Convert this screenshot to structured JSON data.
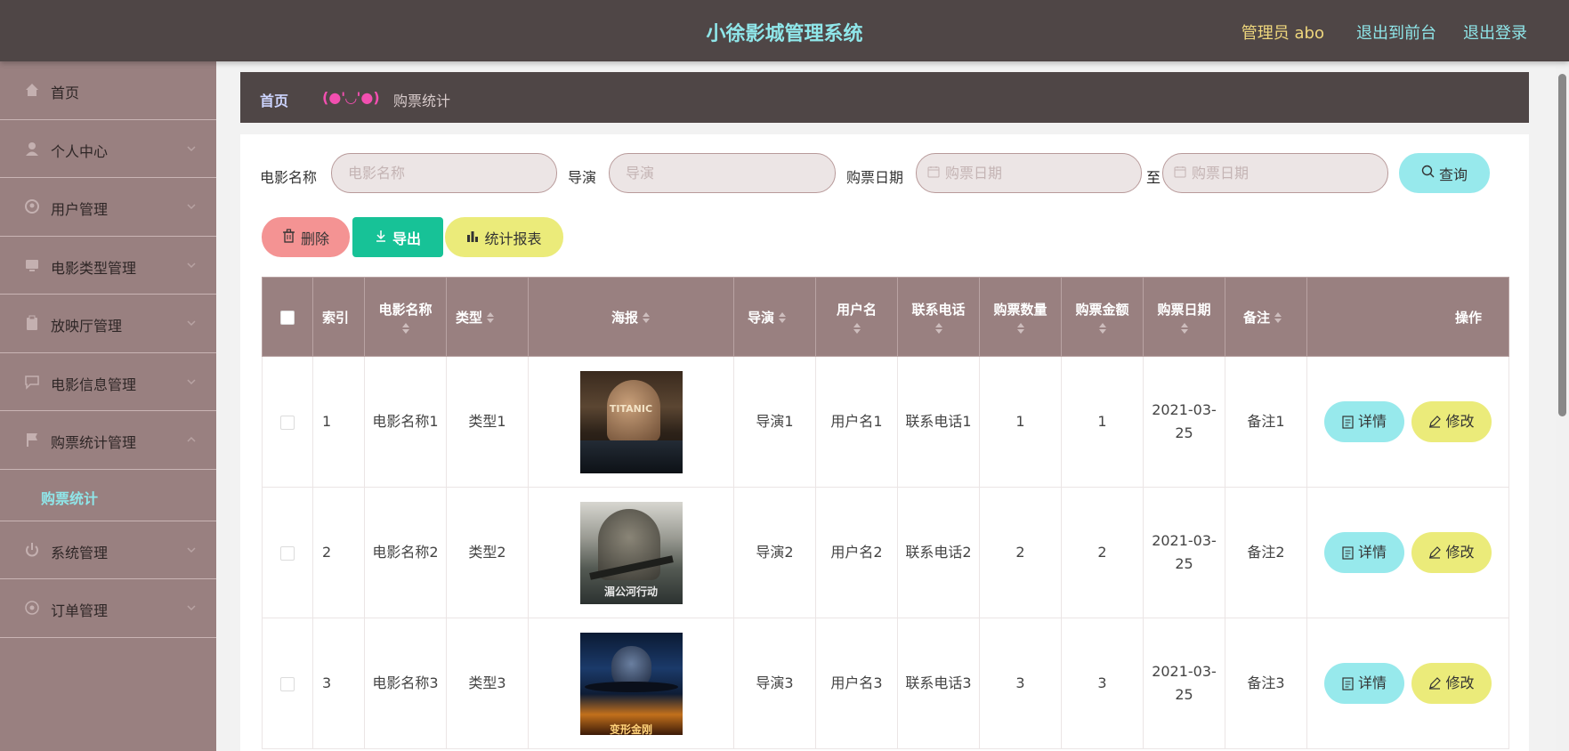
{
  "header": {
    "title": "小徐影城管理系统",
    "user_label": "管理员 abo",
    "to_front": "退出到前台",
    "logout": "退出登录"
  },
  "sidebar": {
    "items": [
      {
        "label": "首页",
        "icon": "home-icon"
      },
      {
        "label": "个人中心",
        "icon": "user-icon"
      },
      {
        "label": "用户管理",
        "icon": "users-icon"
      },
      {
        "label": "电影类型管理",
        "icon": "monitor-icon"
      },
      {
        "label": "放映厅管理",
        "icon": "clipboard-icon"
      },
      {
        "label": "电影信息管理",
        "icon": "message-icon"
      },
      {
        "label": "购票统计管理",
        "icon": "flag-icon"
      },
      {
        "label": "系统管理",
        "icon": "power-icon"
      },
      {
        "label": "订单管理",
        "icon": "settings-icon"
      }
    ],
    "submenu": {
      "label": "购票统计"
    }
  },
  "breadcrumb": {
    "home": "首页",
    "separator": "(●'◡'●)",
    "current": "购票统计"
  },
  "search": {
    "movie_name_label": "电影名称",
    "movie_name_placeholder": "电影名称",
    "director_label": "导演",
    "director_placeholder": "导演",
    "date_label": "购票日期",
    "date_start_placeholder": "购票日期",
    "date_to": "至",
    "date_end_placeholder": "购票日期",
    "query_button": "查询"
  },
  "actions": {
    "delete": "删除",
    "export": "导出",
    "report": "统计报表"
  },
  "table": {
    "columns": [
      "索引",
      "电影名称",
      "类型",
      "海报",
      "导演",
      "用户名",
      "联系电话",
      "购票数量",
      "购票金额",
      "购票日期",
      "备注",
      "操作"
    ],
    "detail_label": "详情",
    "edit_label": "修改",
    "rows": [
      {
        "index": "1",
        "name": "电影名称1",
        "type": "类型1",
        "poster_text": "TITANIC",
        "director": "导演1",
        "username": "用户名1",
        "phone": "联系电话1",
        "qty": "1",
        "amount": "1",
        "date": "2021-03-25",
        "remark": "备注1"
      },
      {
        "index": "2",
        "name": "电影名称2",
        "type": "类型2",
        "poster_text": "湄公河行动",
        "director": "导演2",
        "username": "用户名2",
        "phone": "联系电话2",
        "qty": "2",
        "amount": "2",
        "date": "2021-03-25",
        "remark": "备注2"
      },
      {
        "index": "3",
        "name": "电影名称3",
        "type": "类型3",
        "poster_text": "变形金刚",
        "director": "导演3",
        "username": "用户名3",
        "phone": "联系电话3",
        "qty": "3",
        "amount": "3",
        "date": "2021-03-25",
        "remark": "备注3"
      }
    ]
  },
  "colors": {
    "header_bg": "#4f4646",
    "sidebar_bg": "#998080",
    "accent_cyan": "#97e9ec",
    "accent_yellow": "#ebeb7a",
    "accent_red": "#f49393",
    "accent_green": "#17c297"
  }
}
